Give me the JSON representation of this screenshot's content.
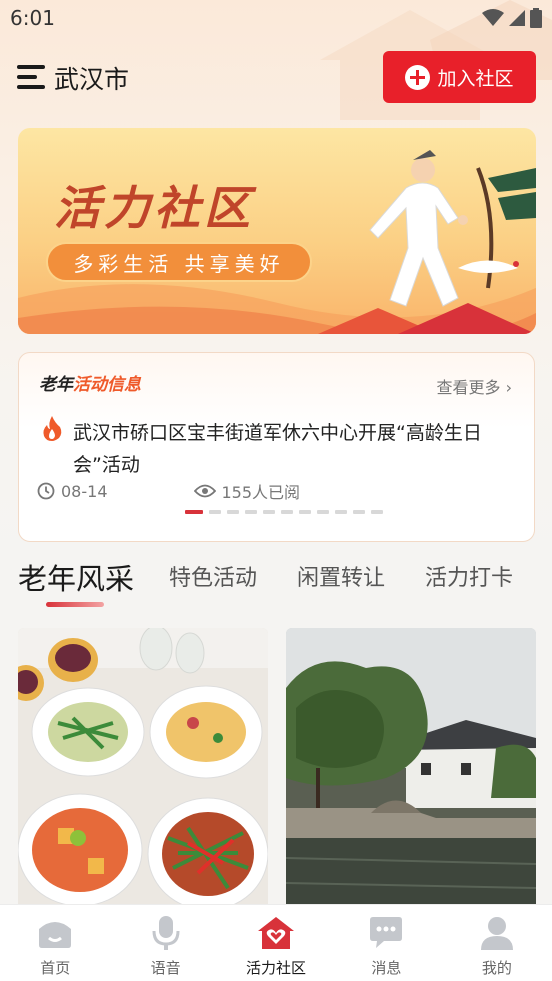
{
  "status_bar": {
    "time": "6:01"
  },
  "header": {
    "city": "武汉市",
    "join_label": "加入社区"
  },
  "banner": {
    "title": "活力社区",
    "slogan": "多彩生活 共享美好"
  },
  "news": {
    "section_title_part1": "老年",
    "section_title_part2": "活动信息",
    "more_label": "查看更多",
    "title": "武汉市硚口区宝丰街道军休六中心开展“高龄生日会”活动",
    "date": "08-14",
    "views": "155人已阅",
    "carousel": {
      "total": 11,
      "active_index": 0
    }
  },
  "tabs": [
    {
      "label": "老年风采",
      "active": true
    },
    {
      "label": "特色活动",
      "active": false
    },
    {
      "label": "闲置转让",
      "active": false
    },
    {
      "label": "活力打卡",
      "active": false
    }
  ],
  "feed": [
    {
      "image": "food-dishes-photo"
    },
    {
      "image": "canal-town-photo"
    }
  ],
  "bottom_nav": [
    {
      "label": "首页",
      "icon": "home-icon",
      "active": false
    },
    {
      "label": "语音",
      "icon": "microphone-icon",
      "active": false
    },
    {
      "label": "活力社区",
      "icon": "community-heart-icon",
      "active": true
    },
    {
      "label": "消息",
      "icon": "message-icon",
      "active": false
    },
    {
      "label": "我的",
      "icon": "user-icon",
      "active": false
    }
  ],
  "colors": {
    "accent": "#e8202a",
    "news_orange": "#ef5a2a",
    "banner_title": "#c0452a"
  }
}
